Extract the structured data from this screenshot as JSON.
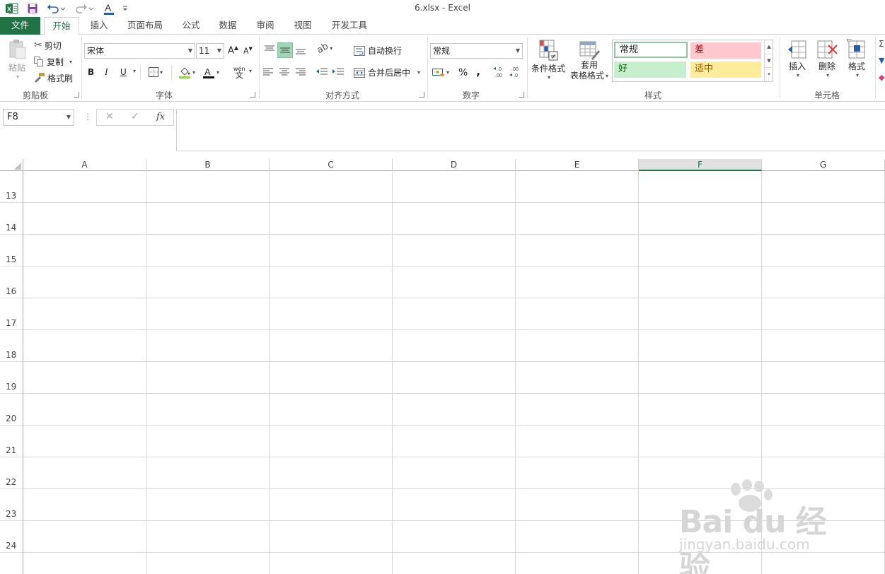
{
  "window": {
    "title": "6.xlsx - Excel"
  },
  "quick_access": [
    "excel-logo-icon",
    "save-icon",
    "undo-icon",
    "redo-icon",
    "font-color-icon",
    "customize-icon"
  ],
  "tabs": [
    {
      "label": "文件",
      "name": "tab-file"
    },
    {
      "label": "开始",
      "name": "tab-home"
    },
    {
      "label": "插入",
      "name": "tab-insert"
    },
    {
      "label": "页面布局",
      "name": "tab-page-layout"
    },
    {
      "label": "公式",
      "name": "tab-formulas"
    },
    {
      "label": "数据",
      "name": "tab-data"
    },
    {
      "label": "审阅",
      "name": "tab-review"
    },
    {
      "label": "视图",
      "name": "tab-view"
    },
    {
      "label": "开发工具",
      "name": "tab-developer"
    }
  ],
  "ribbon": {
    "clipboard": {
      "label": "剪贴板",
      "paste": "粘贴",
      "cut": "剪切",
      "copy": "复制",
      "format_painter": "格式刷"
    },
    "font": {
      "label": "字体",
      "name": "宋体",
      "size": "11",
      "bold": "B",
      "italic": "I",
      "underline": "U",
      "phonetic": "wén"
    },
    "alignment": {
      "label": "对齐方式",
      "wrap_text": "自动换行",
      "merge_center": "合并后居中"
    },
    "number": {
      "label": "数字",
      "format": "常规",
      "percent": "%",
      "comma": ","
    },
    "styles": {
      "label": "样式",
      "conditional": "条件格式",
      "table_format_1": "套用",
      "table_format_2": "表格格式",
      "normal": "常规",
      "bad": "差",
      "good": "好",
      "neutral": "适中",
      "colors": {
        "good_bg": "#c6efce",
        "good_fg": "#006100",
        "bad_bg": "#ffc7ce",
        "bad_fg": "#9c0006",
        "neutral_bg": "#ffeb9c",
        "neutral_fg": "#9c5700"
      }
    },
    "cells": {
      "label": "单元格",
      "insert": "插入",
      "delete": "删除",
      "format": "格式"
    }
  },
  "formula_bar": {
    "name_box": "F8",
    "cancel": "✕",
    "enter": "✓",
    "fx": "fx",
    "value": ""
  },
  "grid": {
    "columns": [
      "A",
      "B",
      "C",
      "D",
      "E",
      "F",
      "G"
    ],
    "selected_column": "F",
    "rows": [
      "13",
      "14",
      "15",
      "16",
      "17",
      "18",
      "19",
      "20",
      "21",
      "22",
      "23",
      "24"
    ]
  },
  "watermark": {
    "logo": "Bai du 经验",
    "url": "jingyan.baidu.com"
  },
  "accent": "#217346"
}
